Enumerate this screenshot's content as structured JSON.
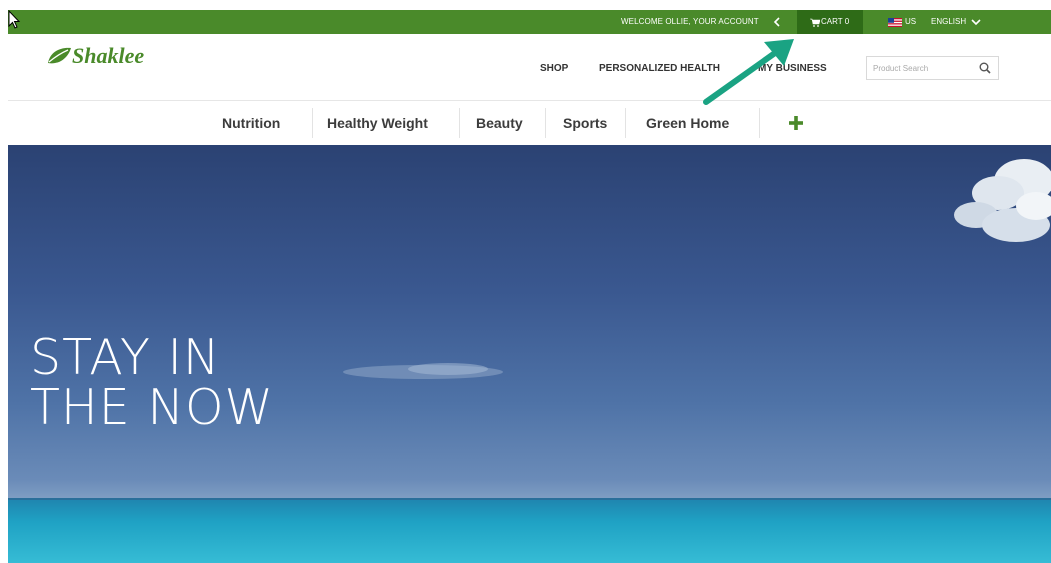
{
  "utility_bar": {
    "welcome_text": "WELCOME OLLIE, YOUR ACCOUNT",
    "cart_label": "CART 0",
    "country": "US",
    "language": "ENGLISH",
    "bg_color": "#4a8a2a",
    "cart_bg_color": "#2e6b17"
  },
  "brand": {
    "name": "Shaklee",
    "color": "#4a8a2a"
  },
  "main_nav": {
    "items": [
      "SHOP",
      "PERSONALIZED HEALTH",
      "MY BUSINESS"
    ]
  },
  "search": {
    "placeholder": "Product Search",
    "icon": "search-icon"
  },
  "category_nav": {
    "items": [
      "Nutrition",
      "Healthy Weight",
      "Beauty",
      "Sports",
      "Green Home"
    ],
    "more_icon": "plus-icon"
  },
  "hero": {
    "headline_line1": "STAY IN",
    "headline_line2": "THE NOW"
  },
  "annotation": {
    "arrow_color": "#1aa383"
  }
}
